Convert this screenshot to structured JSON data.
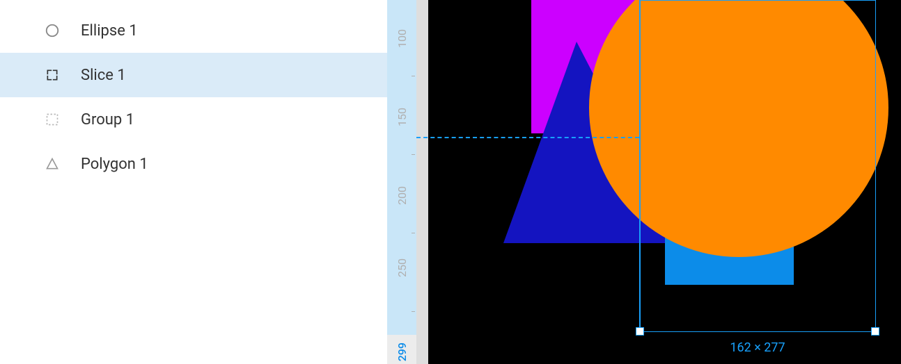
{
  "layers": {
    "items": [
      {
        "label": "Ellipse 1",
        "icon": "ellipse-icon",
        "selected": false
      },
      {
        "label": "Slice 1",
        "icon": "slice-icon",
        "selected": true
      },
      {
        "label": "Group 1",
        "icon": "group-icon",
        "selected": false
      },
      {
        "label": "Polygon 1",
        "icon": "polygon-icon",
        "selected": false
      }
    ]
  },
  "ruler": {
    "ticks": [
      "100",
      "150",
      "200",
      "250"
    ],
    "current": "299"
  },
  "canvas": {
    "shapes": {
      "rect_magenta": {
        "color": "#cc00ff"
      },
      "triangle_blue": {
        "color": "#1212b9"
      },
      "square_blue": {
        "color": "#0c8ce9"
      },
      "circle_orange": {
        "color": "#ff8a00"
      }
    },
    "selection": {
      "dimensions_label": "162 × 277"
    }
  },
  "colors": {
    "accent": "#18a0fb"
  }
}
